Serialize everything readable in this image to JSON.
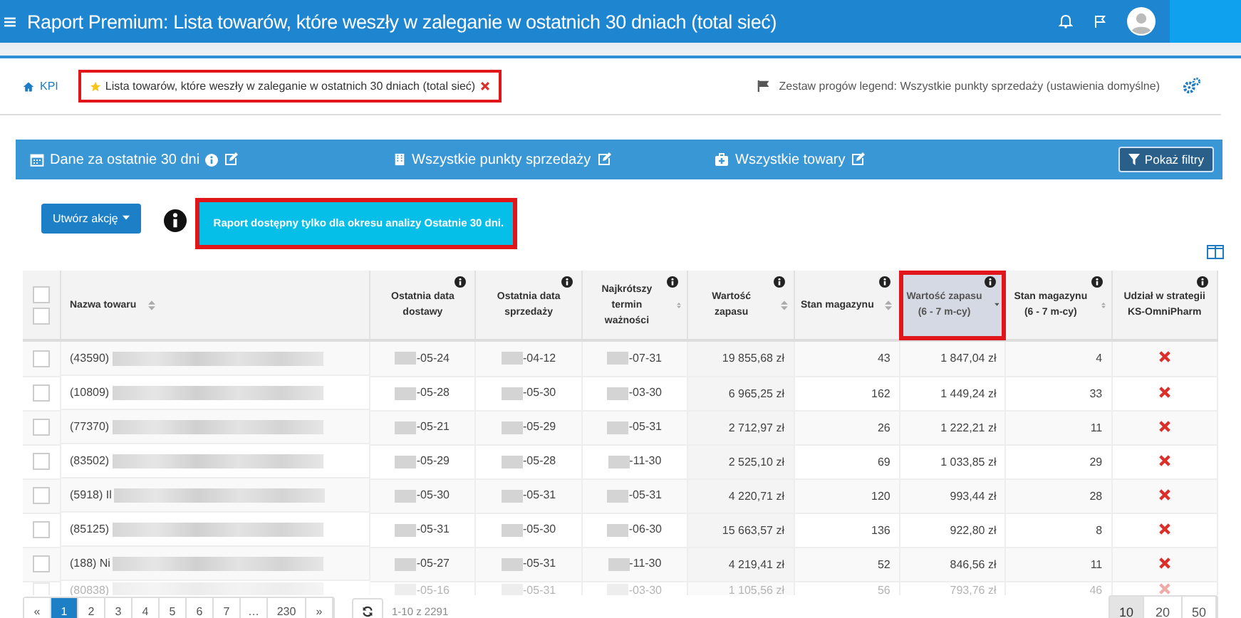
{
  "topbar": {
    "title": "Raport Premium: Lista towarów, które weszły w zaleganie w ostatnich 30 dniach (total sieć)"
  },
  "breadcrumb": {
    "home": "KPI",
    "current": "Lista towarów, które weszły w zaleganie w ostatnich 30 dniach (total sieć)",
    "favorite": true,
    "legend": "Zestaw progów legend: Wszystkie punkty sprzedaży (ustawienia domyślne)"
  },
  "filters": [
    {
      "kind": "calendar",
      "label": "Dane za ostatnie 30 dni",
      "info": true
    },
    {
      "kind": "store",
      "label": "Wszystkie punkty sprzedaży",
      "info": false
    },
    {
      "kind": "products",
      "label": "Wszystkie towary",
      "info": false
    }
  ],
  "show_filters": "Pokaż filtry",
  "action_button": "Utwórz akcję",
  "notice": "Raport dostępny tylko dla okresu analizy Ostatnie 30 dni.",
  "table": {
    "header_checkboxes": [
      {
        "checked": false
      },
      {
        "checked": false
      }
    ],
    "columns": [
      {
        "label": "Nazwa towaru",
        "sortable": true,
        "sorted": false,
        "info": false,
        "selected": false
      },
      {
        "label": "Ostatnia data dostawy",
        "sortable": false,
        "info": true,
        "selected": false
      },
      {
        "label": "Ostatnia data sprzedaży",
        "sortable": false,
        "info": true,
        "selected": false
      },
      {
        "label": "Najkrótszy termin ważności",
        "sortable": true,
        "sorted": false,
        "info": true,
        "selected": false
      },
      {
        "label": "Wartość zapasu",
        "sortable": true,
        "sorted": false,
        "info": true,
        "selected": false
      },
      {
        "label": "Stan magazynu",
        "sortable": true,
        "sorted": false,
        "info": true,
        "selected": false
      },
      {
        "label": "Wartość zapasu (6 - 7 m-cy)",
        "sortable": true,
        "sorted": true,
        "info": true,
        "selected": true
      },
      {
        "label": "Stan magazynu (6 - 7 m-cy)",
        "sortable": true,
        "sorted": false,
        "info": true,
        "selected": false
      },
      {
        "label": "Udział w strategii KS-OmniPharm",
        "sortable": false,
        "info": true,
        "selected": false
      }
    ],
    "rows": [
      {
        "checked": false,
        "name": "(43590)",
        "delivery": "-05-24",
        "sale": "-04-12",
        "expiry": "-07-31",
        "value": "19 855,68 zł",
        "stock": "43",
        "value_6_7": "1 847,04 zł",
        "stock_6_7": "4",
        "in_strategy": false,
        "faded": false
      },
      {
        "checked": false,
        "name": "(10809)",
        "delivery": "-05-28",
        "sale": "-05-30",
        "expiry": "-03-30",
        "value": "6 965,25 zł",
        "stock": "162",
        "value_6_7": "1 449,24 zł",
        "stock_6_7": "33",
        "in_strategy": false,
        "faded": false
      },
      {
        "checked": false,
        "name": "(77370)",
        "delivery": "-05-21",
        "sale": "-05-29",
        "expiry": "-05-31",
        "value": "2 712,97 zł",
        "stock": "26",
        "value_6_7": "1 222,21 zł",
        "stock_6_7": "11",
        "in_strategy": false,
        "faded": false
      },
      {
        "checked": false,
        "name": "(83502)",
        "delivery": "-05-29",
        "sale": "-05-28",
        "expiry": "-11-30",
        "value": "2 525,10 zł",
        "stock": "69",
        "value_6_7": "1 033,85 zł",
        "stock_6_7": "29",
        "in_strategy": false,
        "faded": false
      },
      {
        "checked": false,
        "name": "(5918) Il",
        "delivery": "-05-30",
        "sale": "-05-31",
        "expiry": "-05-31",
        "value": "4 220,71 zł",
        "stock": "120",
        "value_6_7": "993,44 zł",
        "stock_6_7": "28",
        "in_strategy": false,
        "faded": false
      },
      {
        "checked": false,
        "name": "(85125)",
        "delivery": "-05-31",
        "sale": "-05-30",
        "expiry": "-06-30",
        "value": "15 663,57 zł",
        "stock": "136",
        "value_6_7": "922,80 zł",
        "stock_6_7": "8",
        "in_strategy": false,
        "faded": false
      },
      {
        "checked": false,
        "name": "(188) Ni",
        "delivery": "-05-27",
        "sale": "-05-31",
        "expiry": "-11-30",
        "value": "4 219,41 zł",
        "stock": "52",
        "value_6_7": "846,56 zł",
        "stock_6_7": "11",
        "in_strategy": false,
        "faded": false
      },
      {
        "checked": false,
        "name": "(80838)",
        "delivery": "-05-16",
        "sale": "-05-31",
        "expiry": "-03-30",
        "value": "1 105,56 zł",
        "stock": "56",
        "value_6_7": "793,76 zł",
        "stock_6_7": "46",
        "in_strategy": false,
        "faded": true
      }
    ]
  },
  "pagination": {
    "prev": "«",
    "next": "»",
    "pages": [
      {
        "label": "1",
        "selected": true
      },
      {
        "label": "2",
        "selected": false
      },
      {
        "label": "3",
        "selected": false
      },
      {
        "label": "4",
        "selected": false
      },
      {
        "label": "5",
        "selected": false
      },
      {
        "label": "6",
        "selected": false
      },
      {
        "label": "7",
        "selected": false
      },
      {
        "label": "…",
        "selected": false
      },
      {
        "label": "230",
        "selected": false
      }
    ],
    "range": "1-10 z 2291",
    "page_sizes": [
      {
        "label": "10",
        "selected": true
      },
      {
        "label": "20",
        "selected": false
      },
      {
        "label": "50",
        "selected": false
      }
    ]
  }
}
